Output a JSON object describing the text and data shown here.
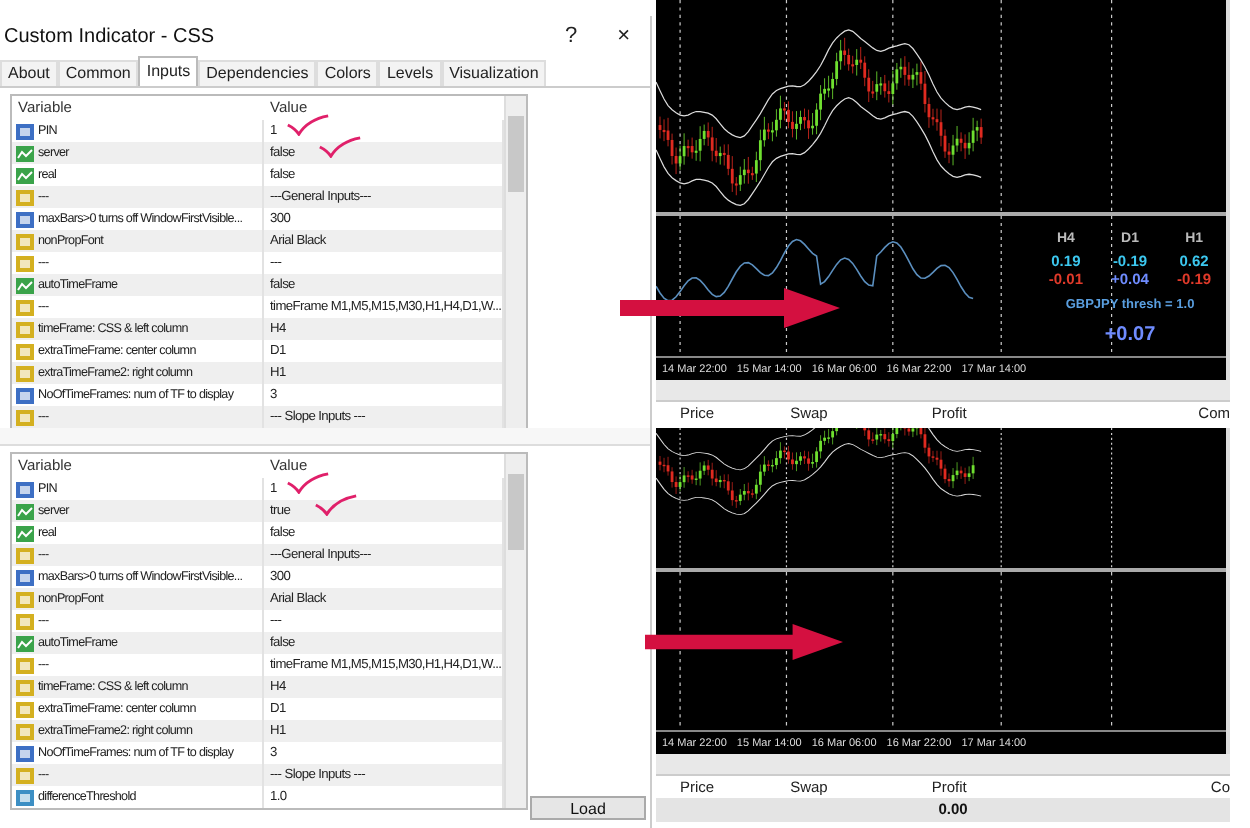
{
  "panels": [
    {
      "dialog": {
        "title": "Custom Indicator - CSS",
        "help": "?",
        "close": "×",
        "tabs": [
          {
            "label": "About",
            "selected": false
          },
          {
            "label": "Common",
            "selected": false
          },
          {
            "label": "Inputs",
            "selected": true
          },
          {
            "label": "Dependencies",
            "selected": false
          },
          {
            "label": "Colors",
            "selected": false
          },
          {
            "label": "Levels",
            "selected": false
          },
          {
            "label": "Visualization",
            "selected": false
          }
        ],
        "columns": [
          "Variable",
          "Value"
        ],
        "rows": [
          {
            "kind": "int",
            "variable": "PIN",
            "value": "1",
            "marked": true
          },
          {
            "kind": "bool",
            "variable": "server",
            "value": "false",
            "marked": true
          },
          {
            "kind": "bool",
            "variable": "real",
            "value": "false",
            "marked": false
          },
          {
            "kind": "string",
            "variable": "---",
            "value": "---General Inputs---",
            "marked": false
          },
          {
            "kind": "int",
            "variable": "maxBars>0 turns off WindowFirstVisible...",
            "value": "300",
            "marked": false
          },
          {
            "kind": "string",
            "variable": "nonPropFont",
            "value": "Arial Black",
            "marked": false
          },
          {
            "kind": "string",
            "variable": "---",
            "value": "---",
            "marked": false
          },
          {
            "kind": "bool",
            "variable": "autoTimeFrame",
            "value": "false",
            "marked": false
          },
          {
            "kind": "string",
            "variable": "---",
            "value": "timeFrame M1,M5,M15,M30,H1,H4,D1,W...",
            "marked": false
          },
          {
            "kind": "string",
            "variable": "timeFrame: CSS & left column",
            "value": "H4",
            "marked": false
          },
          {
            "kind": "string",
            "variable": "extraTimeFrame: center column",
            "value": "D1",
            "marked": false
          },
          {
            "kind": "string",
            "variable": "extraTimeFrame2: right column",
            "value": "H1",
            "marked": false
          },
          {
            "kind": "int",
            "variable": "NoOfTimeFrames: num of TF to display",
            "value": "3",
            "marked": false
          },
          {
            "kind": "string",
            "variable": "---",
            "value": "--- Slope Inputs ---",
            "marked": false
          }
        ]
      },
      "chart": {
        "indicator_line": true,
        "table": {
          "columns": [
            {
              "label": "H4",
              "values": [
                {
                  "text": "0.19",
                  "color": "#3cc8f0"
                },
                {
                  "text": "-0.01",
                  "color": "#e03a2a"
                }
              ]
            },
            {
              "label": "D1",
              "values": [
                {
                  "text": "-0.19",
                  "color": "#3cc8f0"
                },
                {
                  "text": "+0.04",
                  "color": "#6f8cff"
                }
              ]
            },
            {
              "label": "H1",
              "values": [
                {
                  "text": "0.62",
                  "color": "#3cc8f0"
                },
                {
                  "text": "-0.19",
                  "color": "#e03a2a"
                }
              ]
            }
          ],
          "thresh": "GBPJPY thresh = 1.0",
          "total": "+0.07"
        },
        "dates": [
          "14 Mar 22:00",
          "15 Mar 14:00",
          "16 Mar 06:00",
          "16 Mar 22:00",
          "17 Mar 14:00"
        ],
        "trade_columns": [
          "Price",
          "Swap",
          "Profit",
          "Com"
        ]
      },
      "arrow": true
    },
    {
      "dialog": {
        "columns": [
          "Variable",
          "Value"
        ],
        "rows": [
          {
            "kind": "int",
            "variable": "PIN",
            "value": "1",
            "marked": true
          },
          {
            "kind": "bool",
            "variable": "server",
            "value": "true",
            "marked": true
          },
          {
            "kind": "bool",
            "variable": "real",
            "value": "false",
            "marked": false
          },
          {
            "kind": "string",
            "variable": "---",
            "value": "---General Inputs---",
            "marked": false
          },
          {
            "kind": "int",
            "variable": "maxBars>0 turns off WindowFirstVisible...",
            "value": "300",
            "marked": false
          },
          {
            "kind": "string",
            "variable": "nonPropFont",
            "value": "Arial Black",
            "marked": false
          },
          {
            "kind": "string",
            "variable": "---",
            "value": "---",
            "marked": false
          },
          {
            "kind": "bool",
            "variable": "autoTimeFrame",
            "value": "false",
            "marked": false
          },
          {
            "kind": "string",
            "variable": "---",
            "value": "timeFrame M1,M5,M15,M30,H1,H4,D1,W...",
            "marked": false
          },
          {
            "kind": "string",
            "variable": "timeFrame: CSS & left column",
            "value": "H4",
            "marked": false
          },
          {
            "kind": "string",
            "variable": "extraTimeFrame: center column",
            "value": "D1",
            "marked": false
          },
          {
            "kind": "string",
            "variable": "extraTimeFrame2: right column",
            "value": "H1",
            "marked": false
          },
          {
            "kind": "int",
            "variable": "NoOfTimeFrames: num of TF to display",
            "value": "3",
            "marked": false
          },
          {
            "kind": "string",
            "variable": "---",
            "value": "--- Slope Inputs ---",
            "marked": false
          },
          {
            "kind": "double",
            "variable": "differenceThreshold",
            "value": "1.0",
            "marked": false
          }
        ],
        "load": "Load"
      },
      "chart": {
        "indicator_line": false,
        "dates": [
          "14 Mar 22:00",
          "15 Mar 14:00",
          "16 Mar 06:00",
          "16 Mar 22:00",
          "17 Mar 14:00"
        ],
        "trade_columns": [
          "Price",
          "Swap",
          "Profit",
          "Co"
        ],
        "total_profit": "0.00"
      },
      "arrow": true
    }
  ]
}
